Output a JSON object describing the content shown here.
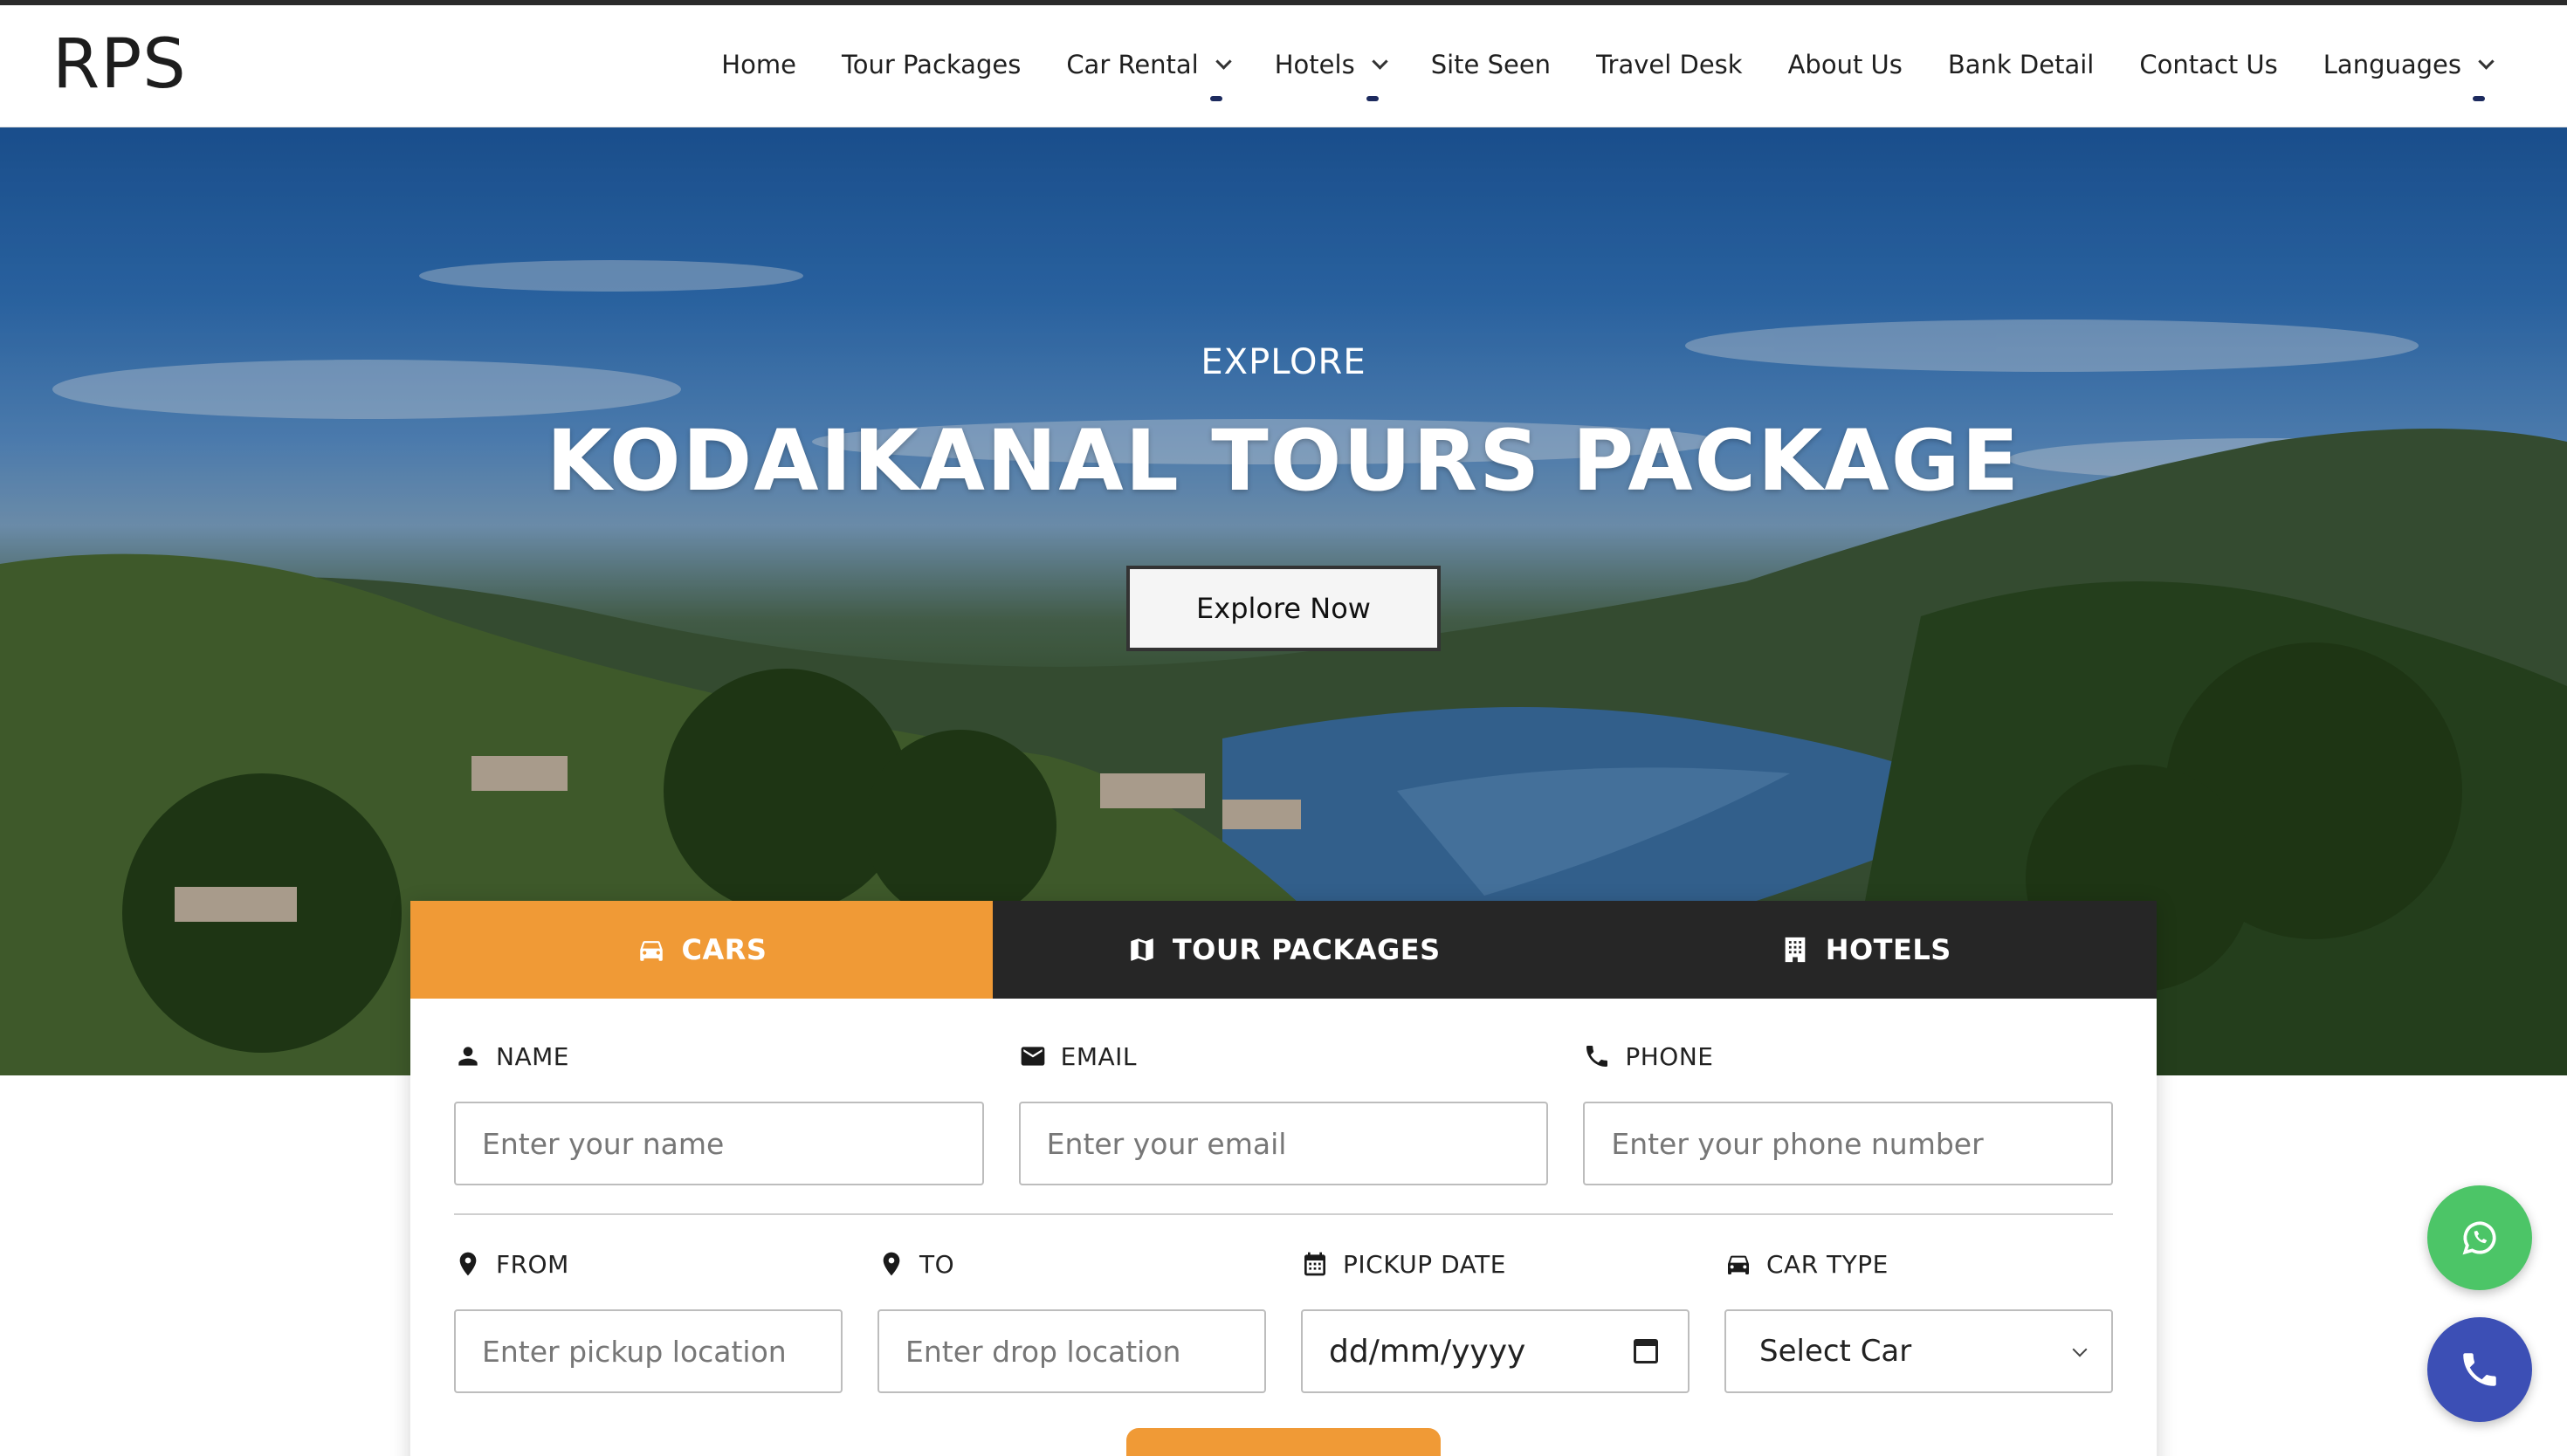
{
  "brand": {
    "logo": "RPS"
  },
  "nav": {
    "items": [
      {
        "label": "Home",
        "dropdown": false
      },
      {
        "label": "Tour Packages",
        "dropdown": false
      },
      {
        "label": "Car Rental",
        "dropdown": true
      },
      {
        "label": "Hotels",
        "dropdown": true
      },
      {
        "label": "Site Seen",
        "dropdown": false
      },
      {
        "label": "Travel Desk",
        "dropdown": false
      },
      {
        "label": "About Us",
        "dropdown": false
      },
      {
        "label": "Bank Detail",
        "dropdown": false
      },
      {
        "label": "Contact Us",
        "dropdown": false
      },
      {
        "label": "Languages",
        "dropdown": true
      }
    ]
  },
  "hero": {
    "subtitle": "EXPLORE",
    "title": "KODAIKANAL TOURS PACKAGE",
    "button": "Explore Now"
  },
  "booking": {
    "tabs": [
      {
        "label": "CARS",
        "icon": "car-icon",
        "active": true
      },
      {
        "label": "TOUR PACKAGES",
        "icon": "map-icon",
        "active": false
      },
      {
        "label": "HOTELS",
        "icon": "building-icon",
        "active": false
      }
    ],
    "fields": {
      "name": {
        "label": "NAME",
        "placeholder": "Enter your name",
        "icon": "person-icon"
      },
      "email": {
        "label": "EMAIL",
        "placeholder": "Enter your email",
        "icon": "mail-icon"
      },
      "phone": {
        "label": "PHONE",
        "placeholder": "Enter your phone number",
        "icon": "phone-icon"
      },
      "from": {
        "label": "FROM",
        "placeholder": "Enter pickup location",
        "icon": "location-pin-icon"
      },
      "to": {
        "label": "TO",
        "placeholder": "Enter drop location",
        "icon": "location-pin-icon"
      },
      "pickup_date": {
        "label": "PICKUP DATE",
        "value": "dd/mm/yyyy",
        "icon": "calendar-icon"
      },
      "car_type": {
        "label": "CAR TYPE",
        "value": "Select Car",
        "icon": "car-icon"
      }
    }
  },
  "floating": {
    "whatsapp_icon": "whatsapp-icon",
    "call_icon": "phone-icon"
  },
  "colors": {
    "accent": "#f09a36",
    "tab_bar": "#262626",
    "whatsapp": "#4cc567",
    "call": "#3c4fb5"
  }
}
